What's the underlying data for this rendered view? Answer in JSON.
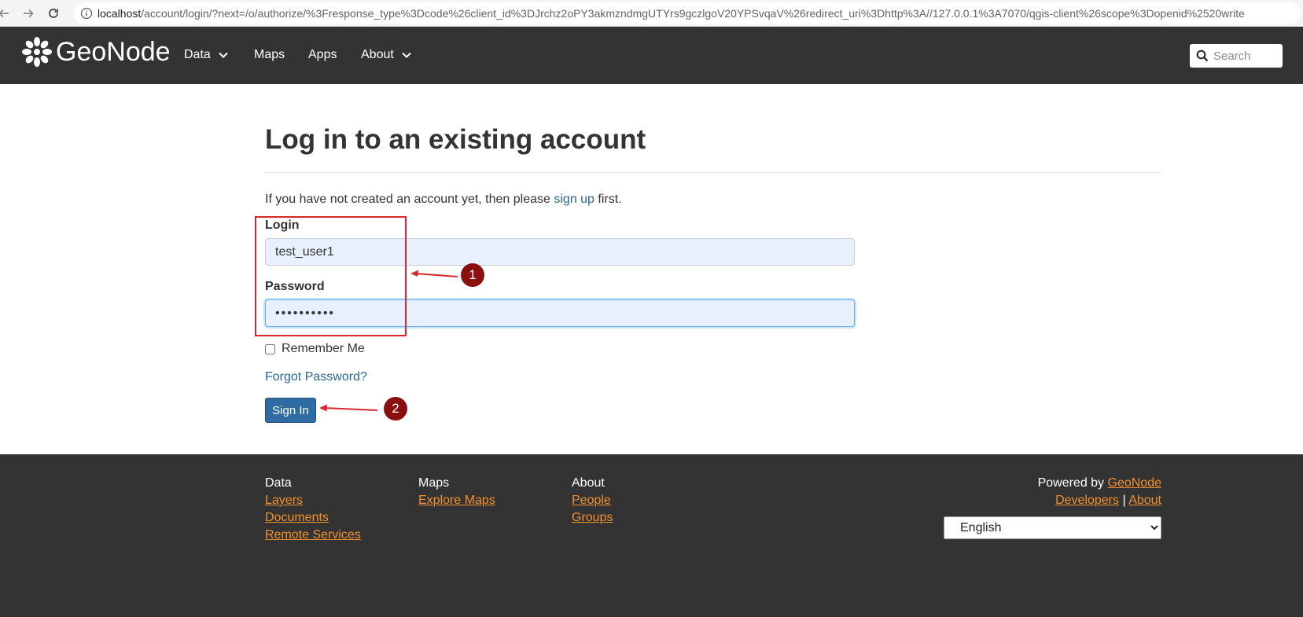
{
  "browser": {
    "url_host": "localhost",
    "url_path": "/account/login/?next=/o/authorize/%3Fresponse_type%3Dcode%26client_id%3DJrchz2oPY3akmzndmgUTYrs9gczlgoV20YPSvqaV%26redirect_uri%3Dhttp%3A//127.0.0.1%3A7070/qgis-client%26scope%3Dopenid%2520write"
  },
  "navbar": {
    "brand": "GeoNode",
    "items": [
      {
        "label": "Data",
        "has_dropdown": true
      },
      {
        "label": "Maps",
        "has_dropdown": false
      },
      {
        "label": "Apps",
        "has_dropdown": false
      },
      {
        "label": "About",
        "has_dropdown": true
      }
    ],
    "search_placeholder": "Search"
  },
  "page": {
    "title": "Log in to an existing account",
    "intro_before": "If you have not created an account yet, then please ",
    "intro_link": "sign up",
    "intro_after": " first.",
    "login_label": "Login",
    "login_value": "test_user1",
    "password_label": "Password",
    "password_value": "••••••••••",
    "remember_label": "Remember Me",
    "forgot_label": "Forgot Password?",
    "signin_label": "Sign In"
  },
  "annotations": {
    "badge1": "1",
    "badge2": "2",
    "color": "#d9272e"
  },
  "footer": {
    "col1_head": "Data",
    "col1_links": [
      "Layers",
      "Documents",
      "Remote Services"
    ],
    "col2_head": "Maps",
    "col2_links": [
      "Explore Maps"
    ],
    "col3_head": "About",
    "col3_links": [
      "People",
      "Groups"
    ],
    "powered_by": "Powered by ",
    "powered_link": "GeoNode",
    "developers": "Developers",
    "sep": " | ",
    "about": "About",
    "language": "English"
  },
  "colors": {
    "navbar_bg": "#333333",
    "link": "#2b6699",
    "footer_link": "#f0902f",
    "button": "#2f6ca3"
  }
}
